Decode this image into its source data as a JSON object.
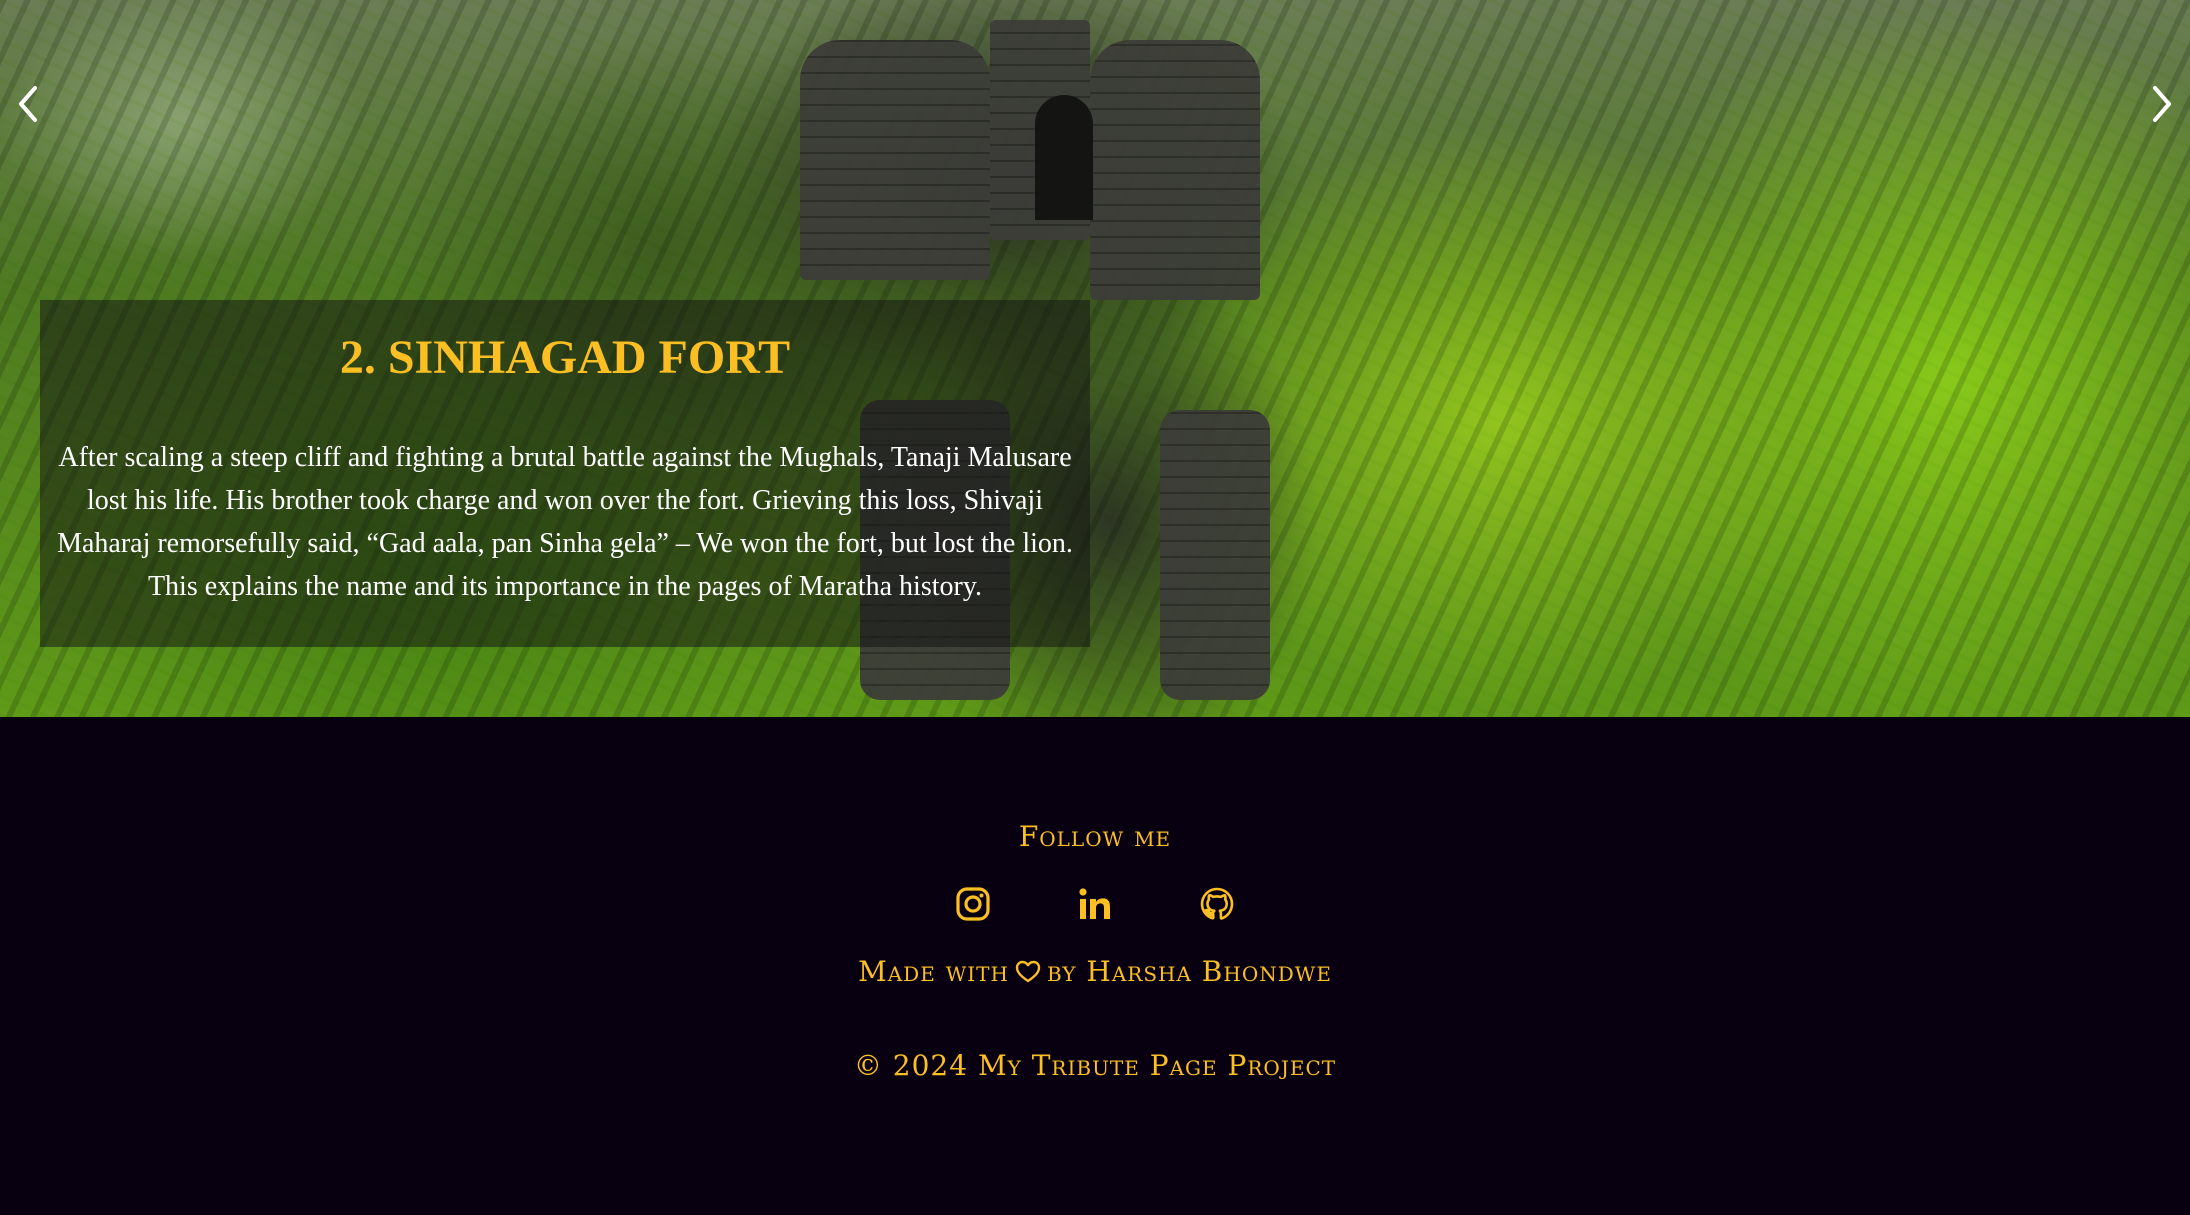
{
  "carousel": {
    "slide": {
      "title": "2. SINHAGAD FORT",
      "description": "After scaling a steep cliff and fighting a brutal battle against the Mughals, Tanaji Malusare lost his life. His brother took charge and won over the fort. Grieving this loss, Shivaji Maharaj remorsefully said, “Gad aala, pan Sinha gela” – We won the fort, but lost the lion. This explains the name and its importance in the pages of Maratha history."
    },
    "prev_icon": "chevron-left-icon",
    "next_icon": "chevron-right-icon"
  },
  "footer": {
    "follow_label": "Follow me",
    "socials": [
      {
        "icon": "instagram-icon"
      },
      {
        "icon": "linkedin-icon"
      },
      {
        "icon": "github-icon"
      }
    ],
    "made_with_prefix": "Made with",
    "made_with_icon": "heart-icon",
    "made_with_suffix": "by Harsha Bhondwe",
    "copyright": "© 2024 My Tribute Page Project"
  },
  "colors": {
    "accent": "#fbbf24",
    "footer_bg": "#080010",
    "caption_bg": "rgba(20,20,20,0.52)"
  }
}
